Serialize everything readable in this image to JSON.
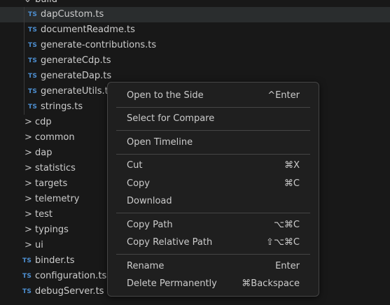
{
  "explorer": {
    "top_folder_label": "build",
    "files": [
      {
        "icon": "TS",
        "label": "dapCustom.ts"
      },
      {
        "icon": "TS",
        "label": "documentReadme.ts"
      },
      {
        "icon": "TS",
        "label": "generate-contributions.ts"
      },
      {
        "icon": "TS",
        "label": "generateCdp.ts"
      },
      {
        "icon": "TS",
        "label": "generateDap.ts"
      },
      {
        "icon": "TS",
        "label": "generateUtils.ts"
      },
      {
        "icon": "TS",
        "label": "strings.ts"
      }
    ],
    "folders": [
      {
        "chevron": ">",
        "label": "cdp"
      },
      {
        "chevron": ">",
        "label": "common"
      },
      {
        "chevron": ">",
        "label": "dap"
      },
      {
        "chevron": ">",
        "label": "statistics"
      },
      {
        "chevron": ">",
        "label": "targets"
      },
      {
        "chevron": ">",
        "label": "telemetry"
      },
      {
        "chevron": ">",
        "label": "test"
      },
      {
        "chevron": ">",
        "label": "typings"
      },
      {
        "chevron": ">",
        "label": "ui"
      }
    ],
    "root_files": [
      {
        "icon": "TS",
        "label": "binder.ts"
      },
      {
        "icon": "TS",
        "label": "configuration.ts"
      },
      {
        "icon": "TS",
        "label": "debugServer.ts"
      }
    ]
  },
  "context_menu": {
    "groups": [
      [
        {
          "label": "Open to the Side",
          "key": "^Enter"
        }
      ],
      [
        {
          "label": "Select for Compare",
          "key": ""
        }
      ],
      [
        {
          "label": "Open Timeline",
          "key": ""
        }
      ],
      [
        {
          "label": "Cut",
          "key": "⌘X"
        },
        {
          "label": "Copy",
          "key": "⌘C"
        },
        {
          "label": "Download",
          "key": ""
        }
      ],
      [
        {
          "label": "Copy Path",
          "key": "⌥⌘C"
        },
        {
          "label": "Copy Relative Path",
          "key": "⇧⌥⌘C"
        }
      ],
      [
        {
          "label": "Rename",
          "key": "Enter"
        },
        {
          "label": "Delete Permanently",
          "key": "⌘Backspace"
        }
      ]
    ]
  }
}
